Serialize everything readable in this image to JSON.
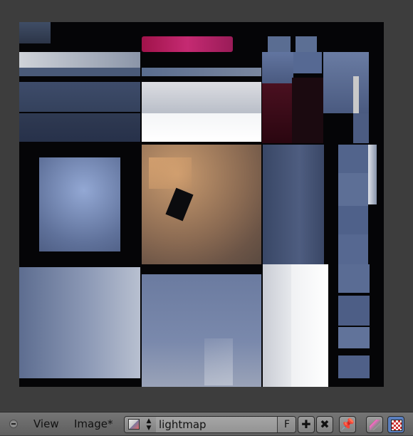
{
  "header": {
    "menus": [
      {
        "label": "View"
      },
      {
        "label": "Image*"
      }
    ],
    "image_selector": {
      "name": "lightmap",
      "fake_user_label": "F",
      "new_icon": "plus-icon",
      "unlink_icon": "x-icon"
    },
    "tools": {
      "pin_icon": "pin-icon",
      "paint_icon": "paint-brush-icon",
      "display_icon": "checker-icon"
    }
  }
}
